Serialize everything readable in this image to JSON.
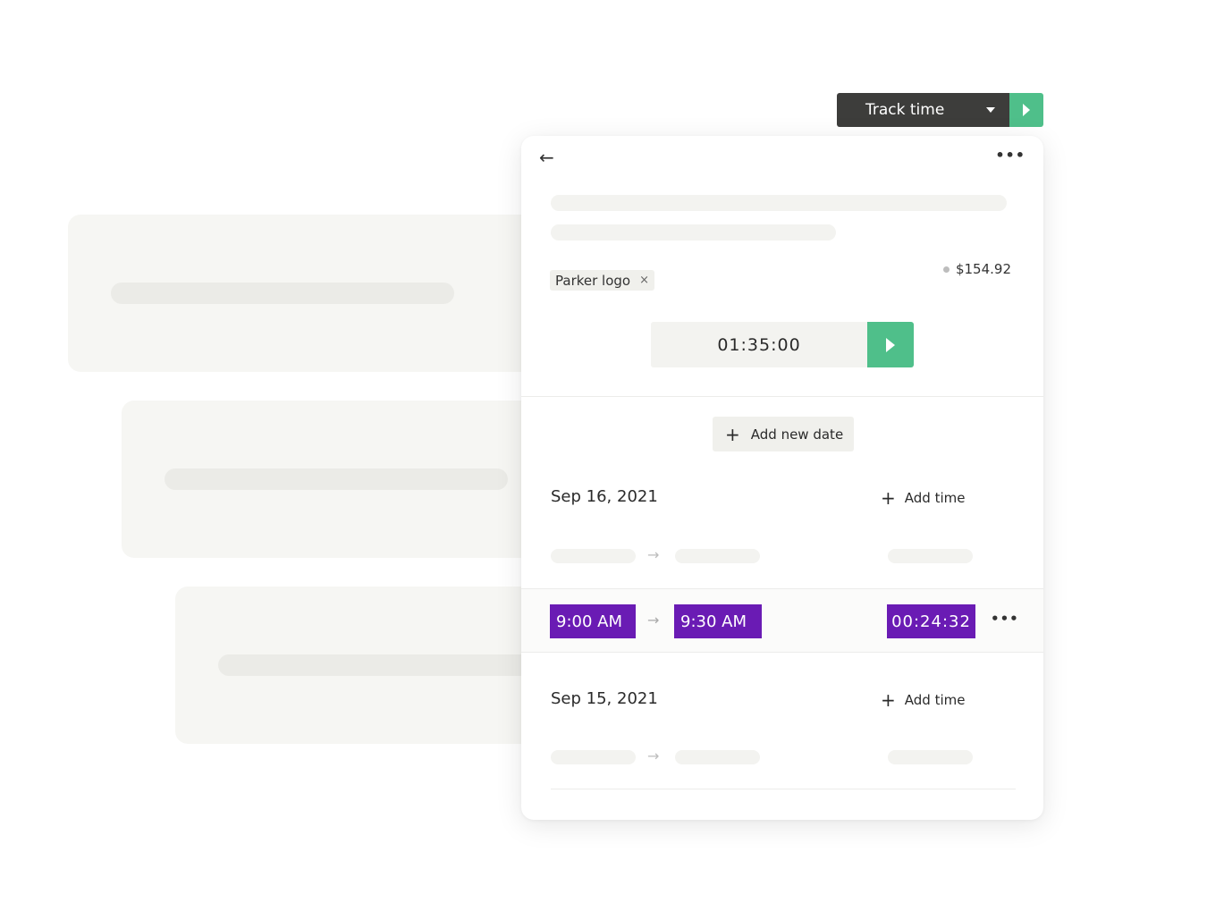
{
  "track_time": {
    "label": "Track time",
    "caret_icon": "caret-down-icon",
    "play_icon": "play-icon",
    "accent_color": "#4fbf8a",
    "bg_color": "#3d3d3b"
  },
  "panel": {
    "back_icon": "←",
    "more_icon": "•••",
    "tag": {
      "label": "Parker logo",
      "remove_icon": "×"
    },
    "amount": "$154.92",
    "timer": {
      "value": "01:35:00"
    },
    "add_new_date": {
      "plus": "+",
      "label": "Add new date"
    },
    "dates": [
      {
        "date": "Sep 16, 2021",
        "add_time_label": "Add time",
        "entry": {
          "start": "9:00 AM",
          "end": "9:30 AM",
          "duration": "00:24:32",
          "arrow": "→",
          "more": "•••"
        }
      },
      {
        "date": "Sep 15, 2021",
        "add_time_label": "Add time"
      }
    ],
    "arrow_glyph": "→",
    "plus_glyph": "+",
    "highlight_color": "#6a1bb4"
  }
}
